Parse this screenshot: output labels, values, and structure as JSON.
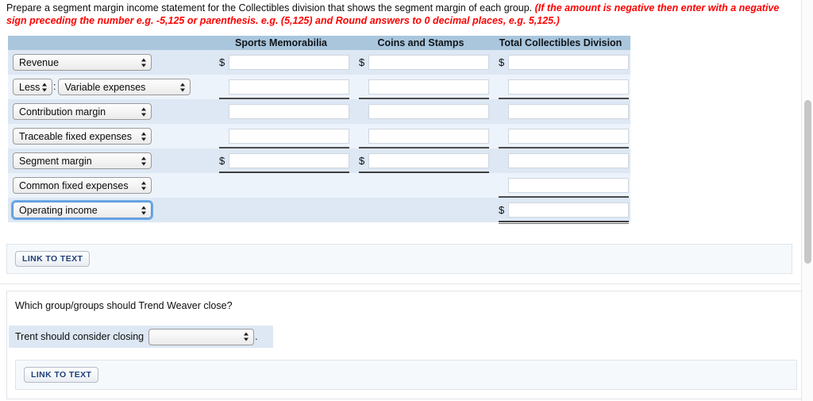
{
  "prompt": {
    "main": "Prepare a segment margin income statement for the Collectibles division that shows the segment margin of each group.",
    "hint": "(If the amount is negative then enter with a negative sign preceding the number e.g. -5,125 or parenthesis. e.g. (5,125) and Round answers to 0 decimal places, e.g. 5,125.)",
    "hint_color": "#ff0000"
  },
  "statement": {
    "columns": [
      {
        "key": "label",
        "header": ""
      },
      {
        "key": "sports",
        "header": "Sports Memorabilia"
      },
      {
        "key": "coins",
        "header": "Coins and Stamps"
      },
      {
        "key": "total",
        "header": "Total Collectibles Division"
      }
    ],
    "header_bg": "#a9c6dd",
    "row_bg_odd": "#dde8f4",
    "row_bg_even": "#edf3fb",
    "rows": [
      {
        "label_select": "Revenue",
        "prefix_select": null,
        "focused": false,
        "cells": [
          {
            "dollar": "$",
            "value": "",
            "rule": "none",
            "visible": true
          },
          {
            "dollar": "$",
            "value": "",
            "rule": "none",
            "visible": true
          },
          {
            "dollar": "$",
            "value": "",
            "rule": "none",
            "visible": true
          }
        ]
      },
      {
        "label_select": "Variable expenses",
        "prefix_select": "Less",
        "separator": ":",
        "focused": false,
        "cells": [
          {
            "dollar": "",
            "value": "",
            "rule": "single",
            "visible": true
          },
          {
            "dollar": "",
            "value": "",
            "rule": "single",
            "visible": true
          },
          {
            "dollar": "",
            "value": "",
            "rule": "single",
            "visible": true
          }
        ]
      },
      {
        "label_select": "Contribution margin",
        "prefix_select": null,
        "focused": false,
        "cells": [
          {
            "dollar": "",
            "value": "",
            "rule": "none",
            "visible": true
          },
          {
            "dollar": "",
            "value": "",
            "rule": "none",
            "visible": true
          },
          {
            "dollar": "",
            "value": "",
            "rule": "none",
            "visible": true
          }
        ]
      },
      {
        "label_select": "Traceable fixed expenses",
        "prefix_select": null,
        "focused": false,
        "cells": [
          {
            "dollar": "",
            "value": "",
            "rule": "single",
            "visible": true
          },
          {
            "dollar": "",
            "value": "",
            "rule": "single",
            "visible": true
          },
          {
            "dollar": "",
            "value": "",
            "rule": "single",
            "visible": true
          }
        ]
      },
      {
        "label_select": "Segment margin",
        "prefix_select": null,
        "focused": false,
        "cells": [
          {
            "dollar": "$",
            "value": "",
            "rule": "double",
            "visible": true
          },
          {
            "dollar": "$",
            "value": "",
            "rule": "double",
            "visible": true
          },
          {
            "dollar": "",
            "value": "",
            "rule": "none",
            "visible": true
          }
        ]
      },
      {
        "label_select": "Common fixed expenses",
        "prefix_select": null,
        "focused": false,
        "cells": [
          {
            "dollar": "",
            "value": "",
            "rule": "none",
            "visible": false
          },
          {
            "dollar": "",
            "value": "",
            "rule": "none",
            "visible": false
          },
          {
            "dollar": "",
            "value": "",
            "rule": "single",
            "visible": true
          }
        ]
      },
      {
        "label_select": "Operating income",
        "prefix_select": null,
        "focused": true,
        "cells": [
          {
            "dollar": "",
            "value": "",
            "rule": "none",
            "visible": false
          },
          {
            "dollar": "",
            "value": "",
            "rule": "none",
            "visible": false
          },
          {
            "dollar": "$",
            "value": "",
            "rule": "double",
            "visible": true
          }
        ]
      }
    ]
  },
  "link_to_text_1": {
    "label": "LINK TO TEXT"
  },
  "question2": {
    "text": "Which group/groups should Trend Weaver close?",
    "answer_prefix": "Trent should consider closing",
    "answer_select_value": "",
    "answer_suffix": "."
  },
  "link_to_text_2": {
    "label": "LINK TO TEXT"
  },
  "amount_placeholder": ""
}
